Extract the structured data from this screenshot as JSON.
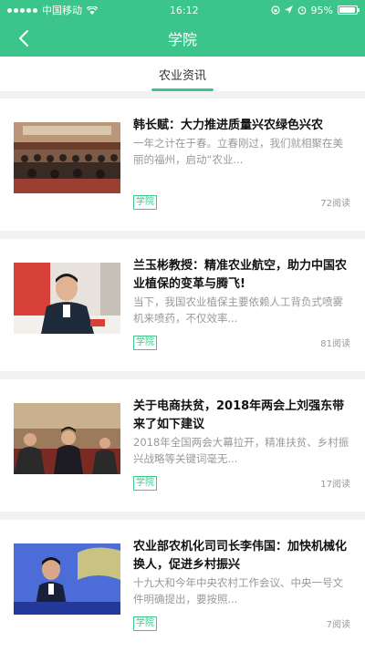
{
  "status": {
    "carrier": "中国移动",
    "time": "16:12",
    "battery": "95%",
    "battery_level": 0.95
  },
  "nav": {
    "title": "学院"
  },
  "tabs": [
    {
      "label": "农业资讯",
      "active": true
    }
  ],
  "articles": [
    {
      "title": "韩长赋：大力推进质量兴农绿色兴农",
      "summary": "一年之计在于春。立春刚过，我们就相聚在美丽的福州，启动“农业...",
      "badge": "学院",
      "reads": "72阅读"
    },
    {
      "title": "兰玉彬教授：精准农业航空，助力中国农业植保的变革与腾飞!",
      "summary": "当下，我国农业植保主要依赖人工背负式喷雾机来喷药，不仅效率...",
      "badge": "学院",
      "reads": "81阅读"
    },
    {
      "title": "关于电商扶贫，2018年两会上刘强东带来了如下建议",
      "summary": "2018年全国两会大幕拉开，精准扶贫、乡村振兴战略等关键词毫无...",
      "badge": "学院",
      "reads": "17阅读"
    },
    {
      "title": "农业部农机化司司长李伟国：加快机械化换人，促进乡村振兴",
      "summary": "十九大和今年中央农村工作会议、中央一号文件明确提出，要按照...",
      "badge": "学院",
      "reads": "7阅读"
    }
  ],
  "colors": {
    "accent": "#3cc58a"
  }
}
